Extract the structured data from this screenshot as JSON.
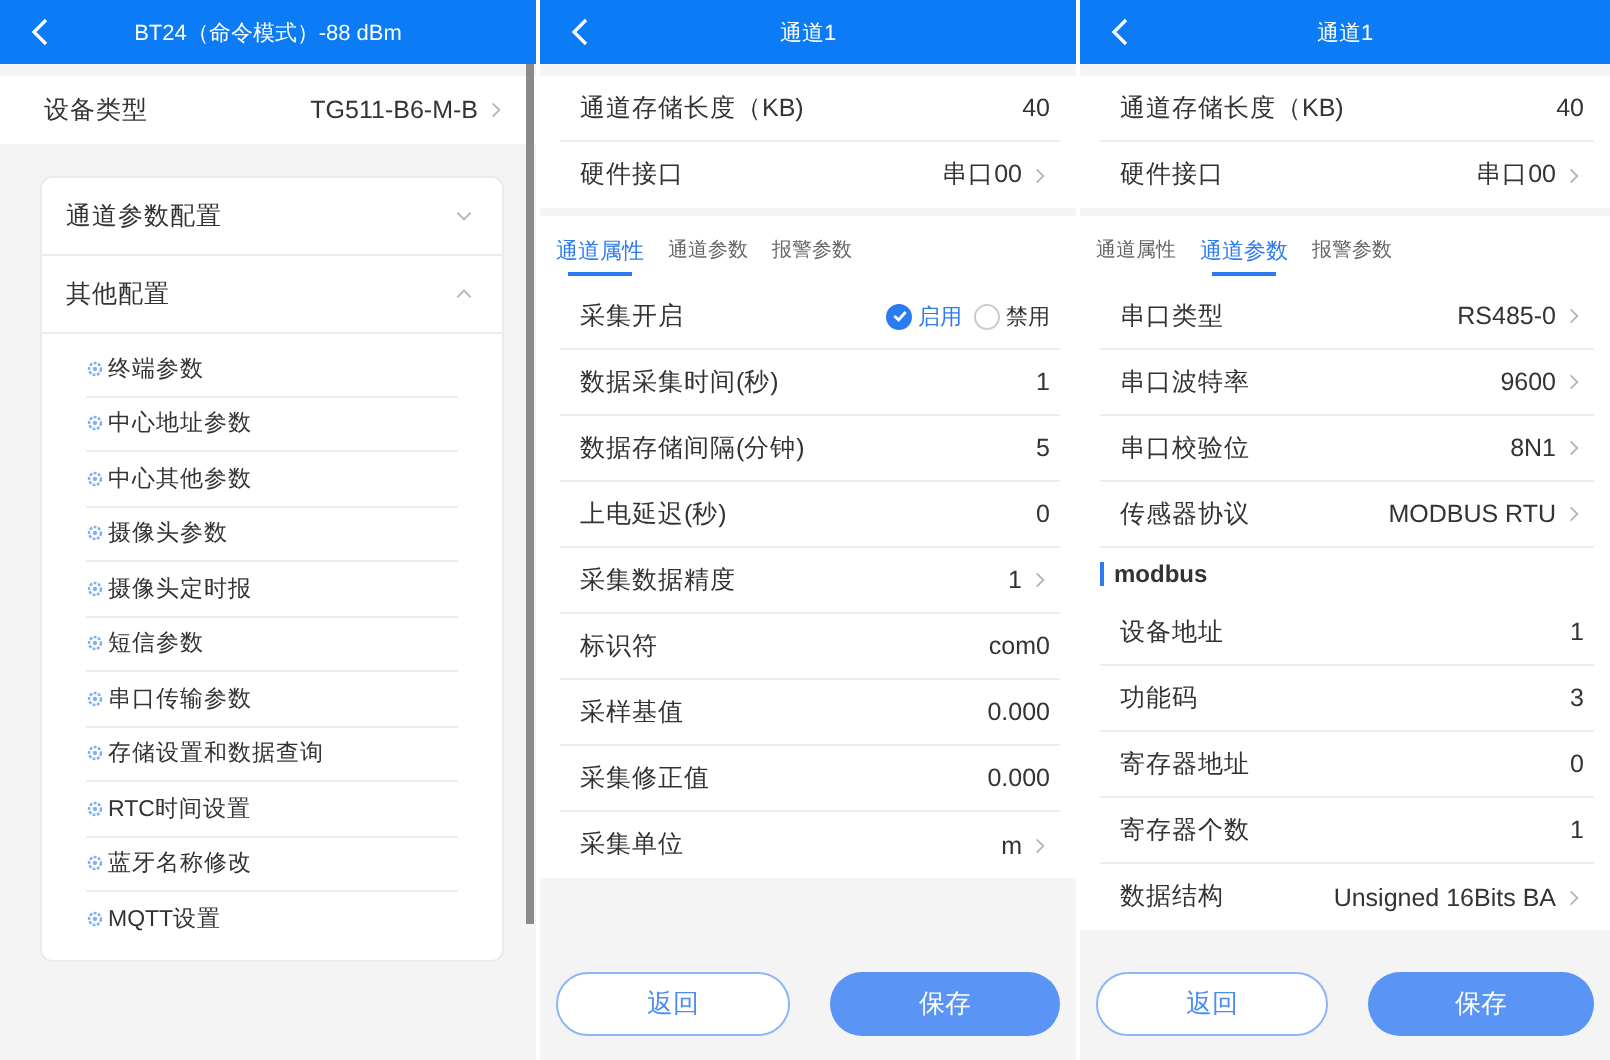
{
  "screens": [
    {
      "kind": "device",
      "header": {
        "title": "BT24（命令模式）-88 dBm"
      },
      "device_type": {
        "label": "设备类型",
        "value": "TG511-B6-M-B",
        "arrow": true
      },
      "sections": [
        {
          "title": "通道参数配置",
          "expanded": false
        },
        {
          "title": "其他配置",
          "expanded": true,
          "items": [
            "终端参数",
            "中心地址参数",
            "中心其他参数",
            "摄像头参数",
            "摄像头定时报",
            "短信参数",
            "串口传输参数",
            "存储设置和数据查询",
            "RTC时间设置",
            "蓝牙名称修改",
            "MQTT设置"
          ]
        }
      ]
    },
    {
      "kind": "channel",
      "header": {
        "title": "通道1"
      },
      "info_rows": [
        {
          "label": "通道存储长度（KB)",
          "value": "40",
          "arrow": false
        },
        {
          "label": "硬件接口",
          "value": "串口00",
          "arrow": true
        }
      ],
      "tabs": [
        {
          "label": "通道属性",
          "selected": true
        },
        {
          "label": "通道参数",
          "selected": false
        },
        {
          "label": "报警参数",
          "selected": false
        }
      ],
      "rows": [
        {
          "kind": "radio",
          "label": "采集开启",
          "options": [
            {
              "label": "启用",
              "selected": true
            },
            {
              "label": "禁用",
              "selected": false
            }
          ]
        },
        {
          "kind": "value",
          "label": "数据采集时间(秒)",
          "value": "1",
          "arrow": false
        },
        {
          "kind": "value",
          "label": "数据存储间隔(分钟)",
          "value": "5",
          "arrow": false
        },
        {
          "kind": "value",
          "label": "上电延迟(秒)",
          "value": "0",
          "arrow": false
        },
        {
          "kind": "value",
          "label": "采集数据精度",
          "value": "1",
          "arrow": true
        },
        {
          "kind": "value",
          "label": "标识符",
          "value": "com0",
          "arrow": false
        },
        {
          "kind": "value",
          "label": "采样基值",
          "value": "0.000",
          "arrow": false
        },
        {
          "kind": "value",
          "label": "采集修正值",
          "value": "0.000",
          "arrow": false
        },
        {
          "kind": "value",
          "label": "采集单位",
          "value": "m",
          "arrow": true
        }
      ],
      "buttons": [
        {
          "label": "返回",
          "kind": "outline"
        },
        {
          "label": "保存",
          "kind": "primary"
        }
      ]
    },
    {
      "kind": "channel",
      "header": {
        "title": "通道1"
      },
      "info_rows": [
        {
          "label": "通道存储长度（KB)",
          "value": "40",
          "arrow": false
        },
        {
          "label": "硬件接口",
          "value": "串口00",
          "arrow": true
        }
      ],
      "tabs": [
        {
          "label": "通道属性",
          "selected": false
        },
        {
          "label": "通道参数",
          "selected": true
        },
        {
          "label": "报警参数",
          "selected": false
        }
      ],
      "rows": [
        {
          "kind": "value",
          "label": "串口类型",
          "value": "RS485-0",
          "arrow": true
        },
        {
          "kind": "value",
          "label": "串口波特率",
          "value": "9600",
          "arrow": true
        },
        {
          "kind": "value",
          "label": "串口校验位",
          "value": "8N1",
          "arrow": true
        },
        {
          "kind": "value",
          "label": "传感器协议",
          "value": "MODBUS RTU",
          "arrow": true
        },
        {
          "kind": "section",
          "label": "modbus"
        },
        {
          "kind": "value",
          "label": "设备地址",
          "value": "1",
          "arrow": false
        },
        {
          "kind": "value",
          "label": "功能码",
          "value": "3",
          "arrow": false
        },
        {
          "kind": "value",
          "label": "寄存器地址",
          "value": "0",
          "arrow": false
        },
        {
          "kind": "value",
          "label": "寄存器个数",
          "value": "1",
          "arrow": false
        },
        {
          "kind": "value",
          "label": "数据结构",
          "value": "Unsigned 16Bits BA",
          "arrow": true
        }
      ],
      "buttons": [
        {
          "label": "返回",
          "kind": "outline"
        },
        {
          "label": "保存",
          "kind": "primary"
        }
      ]
    }
  ]
}
